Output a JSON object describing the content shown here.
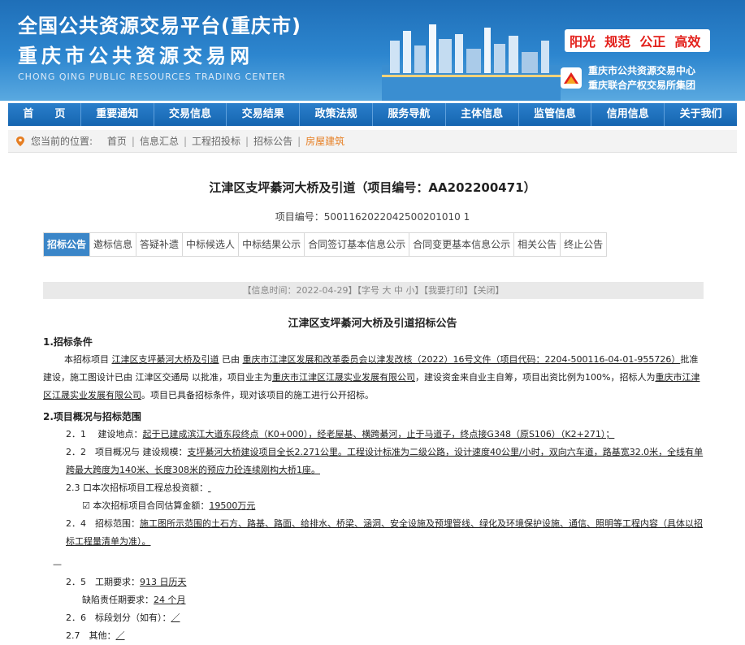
{
  "header": {
    "title_line1": "全国公共资源交易平台(重庆市)",
    "title_line2": "重庆市公共资源交易网",
    "title_en": "CHONG QING PUBLIC RESOURCES TRADING CENTER",
    "slogan": [
      "阳光",
      "规范",
      "公正",
      "高效"
    ],
    "org1": "重庆市公共资源交易中心",
    "org2": "重庆联合产权交易所集团"
  },
  "nav": [
    "首　　页",
    "重要通知",
    "交易信息",
    "交易结果",
    "政策法规",
    "服务导航",
    "主体信息",
    "监管信息",
    "信用信息",
    "关于我们"
  ],
  "breadcrumb": {
    "prefix": "您当前的位置:",
    "items": [
      "首页",
      "信息汇总",
      "工程招投标",
      "招标公告"
    ],
    "current": "房屋建筑"
  },
  "article": {
    "title": "江津区支坪綦河大桥及引道（项目编号：AA202200471）",
    "code_label": "项目编号：",
    "code": "5001162022042500201010 1"
  },
  "tabs": [
    "招标公告",
    "邀标信息",
    "答疑补遗",
    "中标候选人",
    "中标结果公示",
    "合同签订基本信息公示",
    "合同变更基本信息公示",
    "相关公告",
    "终止公告"
  ],
  "infobar": {
    "time": "【信息时间：2022-04-29】",
    "font": "【字号 大 中 小】",
    "print": "【我要打印】",
    "close": "【关闭】"
  },
  "notice": {
    "title": "江津区支坪綦河大桥及引道招标公告",
    "s1_head": "1.招标条件",
    "s1_a": "本招标项目",
    "s1_proj": "江津区支坪綦河大桥及引道",
    "s1_b": "已由",
    "s1_approver": "重庆市江津区发展和改革委员会以津发改核（2022）16号文件（项目代码：2204-500116-04-01-955726）",
    "s1_c": "批准建设，施工图设计已由 江津区交通局 以批准，项目业主为",
    "s1_owner": "重庆市江津区江晟实业发展有限公司",
    "s1_d": "，建设资金来自业主自筹，项目出资比例为100%，招标人为",
    "s1_tenderer": "重庆市江津区江晟实业发展有限公司",
    "s1_e": "。项目已具备招标条件，现对该项目的施工进行公开招标。",
    "s2_head": "2.项目概况与招标范围",
    "s21_label": "2．1　 建设地点：",
    "s21_val": "起于已建成滨江大道东段终点（K0+000），经老屋基、横跨綦河，止于马道子，终点接G348（原S106）（K2+271）；",
    "s22_label": "2．2　项目概况与 建设规模：",
    "s22_val": "支坪綦河大桥建设项目全长2.271公里。工程设计标准为二级公路，设计速度40公里/小时，双向六车道，路基宽32.0米，全线有单跨最大跨度为140米、长度308米的预应力砼连续刚构大桥1座。",
    "s23_label": "2.3 口本次招标项目工程总投资额：",
    "s23_b_label": "☑ 本次招标项目合同估算金额：",
    "s23_b_val": "19500万元",
    "s24_label": "2．4　招标范围：",
    "s24_val": "施工图所示范围的土石方、路基、路面、给排水、桥梁、涵洞、安全设施及预埋管线、绿化及环境保护设施、通信、照明等工程内容（具体以招标工程量清单为准）。",
    "dash": "—",
    "s25_label": "2．5　工期要求：",
    "s25_val": "913 日历天",
    "s25_b_label": "缺陷责任期要求：",
    "s25_b_val": "24 个月",
    "s26_label": "2．6　标段划分（如有）：",
    "s26_val": "／",
    "s27_label": "2.7　其他：",
    "s27_val": "／"
  },
  "colors": {
    "nav": "#1f6fb8",
    "active_tab": "#3b86c8",
    "slogan": "#e3201b",
    "current_crumb": "#e67e22"
  }
}
